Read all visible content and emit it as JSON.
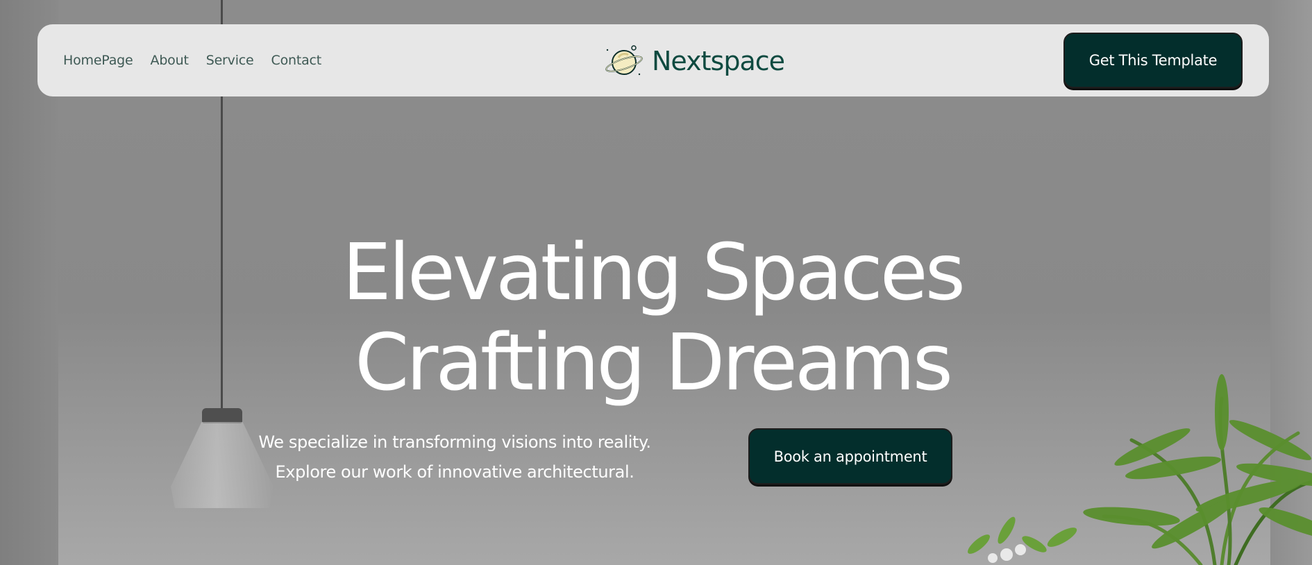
{
  "nav": {
    "links": [
      {
        "label": "HomePage"
      },
      {
        "label": "About"
      },
      {
        "label": "Service"
      },
      {
        "label": "Contact"
      }
    ],
    "brand": {
      "name": "Nextspace",
      "icon": "planet-icon"
    },
    "cta_label": "Get This Template"
  },
  "hero": {
    "title_line1": "Elevating Spaces",
    "title_line2": "Crafting Dreams",
    "subtitle_line1": "We specialize in transforming visions into reality.",
    "subtitle_line2": "Explore our work of innovative architectural.",
    "cta_label": "Book an appointment"
  },
  "colors": {
    "brand": "#0e4a40",
    "button_bg": "#032e2c",
    "nav_bg": "#e7e7e7",
    "nav_text": "#3f5a55"
  }
}
